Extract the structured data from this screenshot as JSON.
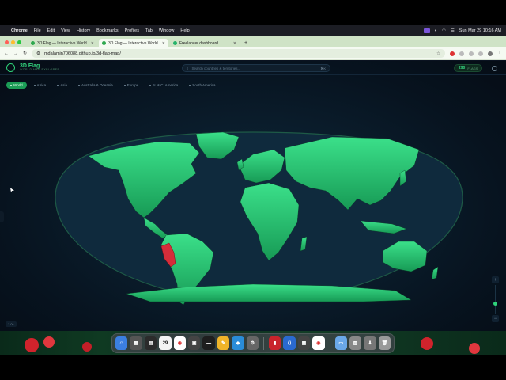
{
  "menubar": {
    "app_name": "Chrome",
    "items": [
      "File",
      "Edit",
      "View",
      "History",
      "Bookmarks",
      "Profiles",
      "Tab",
      "Window",
      "Help"
    ],
    "datetime": "Sun Mar 29  10:16 AM"
  },
  "tabs": [
    {
      "title": "3D Flag — Interactive World",
      "active": false
    },
    {
      "title": "3D Flag — Interactive World",
      "active": true
    },
    {
      "title": "Freelancer dashboard",
      "active": false
    }
  ],
  "url": "mdalamin706088.github.io/3d-flag-map/",
  "app": {
    "brand": "3D Flag",
    "tagline": "WORLD MAP EXPLORER",
    "search_placeholder": "Search countries & territories...",
    "search_shortcut": "⌘K",
    "country_count": "290",
    "country_count_label": "FLAGS",
    "filters": [
      {
        "label": "World",
        "active": true
      },
      {
        "label": "Africa",
        "active": false
      },
      {
        "label": "Asia",
        "active": false
      },
      {
        "label": "Australia & Oceania",
        "active": false
      },
      {
        "label": "Europe",
        "active": false
      },
      {
        "label": "N. & C. America",
        "active": false
      },
      {
        "label": "South America",
        "active": false
      }
    ],
    "zoom_level": "1.0x",
    "colors": {
      "land": "#2fd27a",
      "land_dark": "#1a9e58",
      "highlight": "#d62d3a",
      "ocean": "#0f2a3d",
      "accent": "#2fd27a"
    },
    "highlighted_country": "Peru"
  },
  "dock": {
    "date_icon": "29"
  }
}
